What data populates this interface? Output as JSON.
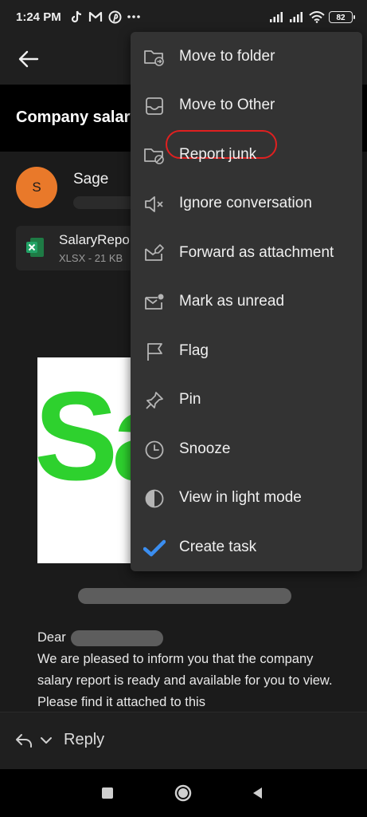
{
  "status_bar": {
    "time": "1:24 PM",
    "left_icons": [
      "tiktok-icon",
      "gmail-icon",
      "pinterest-icon",
      "more-dots-icon"
    ],
    "right_icons": [
      "signal-icon",
      "signal-icon",
      "wifi-icon"
    ],
    "battery": "82"
  },
  "subject": "Company salary",
  "sender": {
    "avatar_letter": "S",
    "avatar_color": "#e9792a",
    "name": "Sage"
  },
  "attachment": {
    "name": "SalaryRepo",
    "meta": "XLSX - 21 KB",
    "icon": "excel-icon"
  },
  "logo_text": "Sa",
  "body": {
    "greeting": "Dear",
    "paragraph": "We are pleased to inform you that the company salary report is ready and available for you to view. Please find it attached to this"
  },
  "reply_bar": {
    "label": "Reply"
  },
  "menu": {
    "items": [
      {
        "label": "Move to folder",
        "icon": "folder-move-icon"
      },
      {
        "label": "Move to Other",
        "icon": "inbox-icon"
      },
      {
        "label": "Report junk",
        "icon": "folder-block-icon",
        "highlight_color": "#e02020"
      },
      {
        "label": "Ignore conversation",
        "icon": "mute-icon"
      },
      {
        "label": "Forward as attachment",
        "icon": "mail-forward-icon"
      },
      {
        "label": "Mark as unread",
        "icon": "mail-unread-icon"
      },
      {
        "label": "Flag",
        "icon": "flag-icon"
      },
      {
        "label": "Pin",
        "icon": "pin-icon"
      },
      {
        "label": "Snooze",
        "icon": "clock-icon"
      },
      {
        "label": "View in light mode",
        "icon": "contrast-icon"
      },
      {
        "label": "Create task",
        "icon": "checkmark-icon",
        "icon_color": "#3b8ef0"
      }
    ]
  },
  "nav_bar": {
    "buttons": [
      "recents-square-icon",
      "home-circle-icon",
      "back-triangle-icon"
    ]
  }
}
